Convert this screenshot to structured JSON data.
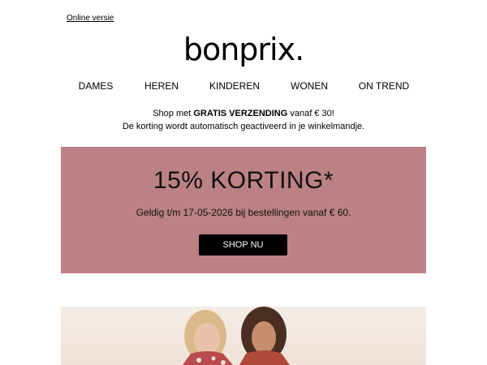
{
  "header": {
    "online_version_label": "Online versie",
    "logo_text": "bonprix."
  },
  "nav": {
    "items": [
      {
        "label": "DAMES"
      },
      {
        "label": "HEREN"
      },
      {
        "label": "KINDEREN"
      },
      {
        "label": "WONEN"
      },
      {
        "label": "ON TREND"
      }
    ]
  },
  "shipping": {
    "line1_prefix": "Shop met ",
    "line1_bold": "GRATIS VERZENDING",
    "line1_suffix": " vanaf € 30!",
    "line2": "De korting wordt automatisch geactiveerd in je winkelmandje."
  },
  "promo": {
    "title": "15% KORTING*",
    "subtitle": "Geldig t/m 17-05-2026 bij bestellingen vanaf € 60.",
    "button_label": "SHOP NU",
    "background_color": "#bc8184"
  }
}
